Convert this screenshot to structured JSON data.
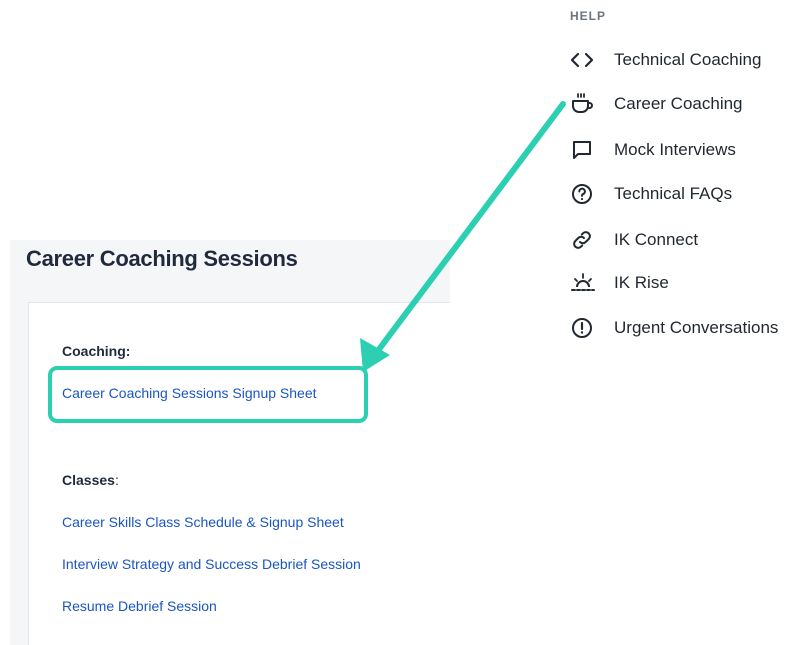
{
  "help_menu": {
    "heading": "HELP",
    "items": [
      {
        "label": "Technical Coaching",
        "icon": "code-brackets-icon"
      },
      {
        "label": "Career Coaching",
        "icon": "coffee-cup-icon"
      },
      {
        "label": "Mock Interviews",
        "icon": "chat-bubble-icon"
      },
      {
        "label": "Technical FAQs",
        "icon": "question-circle-icon"
      },
      {
        "label": "IK Connect",
        "icon": "link-icon"
      },
      {
        "label": "IK Rise",
        "icon": "sunrise-icon"
      },
      {
        "label": "Urgent Conversations",
        "icon": "exclamation-circle-icon"
      }
    ]
  },
  "page": {
    "title": "Career Coaching Sessions",
    "coaching_label": "Coaching:",
    "coaching_link": "Career Coaching Sessions Signup Sheet",
    "classes_label": "Classes",
    "classes_colon": ":",
    "class_links": [
      "Career Skills Class Schedule & Signup Sheet",
      "Interview Strategy and Success Debrief Session",
      "Resume Debrief Session"
    ]
  },
  "colors": {
    "annotation": "#2ccfb2",
    "link": "#1a55c4",
    "title": "#1f2a3d"
  }
}
